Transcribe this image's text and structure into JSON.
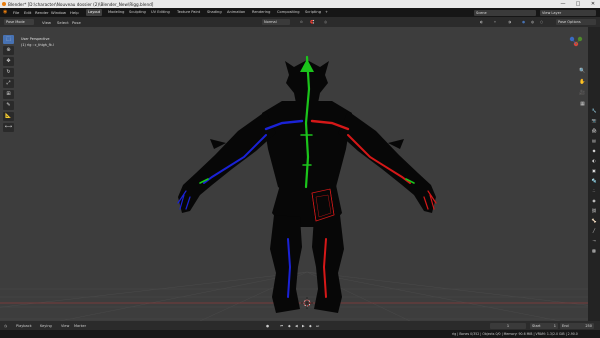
{
  "window": {
    "title": "Blender* [D:\\character\\Nouveau dossier (2)\\Blender_New\\Rigg.blend]",
    "controls": [
      "—",
      "□",
      "✕"
    ]
  },
  "menu": [
    "File",
    "Edit",
    "Render",
    "Window",
    "Help"
  ],
  "workspaces": [
    "Layout",
    "Modeling",
    "Sculpting",
    "UV Editing",
    "Texture Paint",
    "Shading",
    "Animation",
    "Rendering",
    "Compositing",
    "Scripting"
  ],
  "active_workspace": "Layout",
  "add_workspace": "+",
  "scene": {
    "name": "Scene",
    "view_layer": "View Layer"
  },
  "header": {
    "mode": "Pose Mode",
    "view_menu": [
      "View",
      "Select",
      "Pose"
    ],
    "orientation": "Normal",
    "pose_options": "Pose Options"
  },
  "overlay": {
    "line1": "User Perspective",
    "line2": "(1) rig : c_thigh_fk.l"
  },
  "tools": [
    "select-box",
    "cursor",
    "move",
    "rotate",
    "scale",
    "transform",
    "annotate",
    "measure",
    "bone-size"
  ],
  "nav_icons": [
    "zoom-icon",
    "pan-hand-icon",
    "camera-icon",
    "perspective-grid-icon"
  ],
  "properties_icons": [
    "tool-icon",
    "render-icon",
    "output-icon",
    "view-layer-icon",
    "scene-icon",
    "world-icon",
    "object-icon",
    "modifier-icon",
    "particles-icon",
    "physics-icon",
    "constraints-icon",
    "armature-data-icon",
    "bone-icon",
    "bone-constraint-icon",
    "texture-icon"
  ],
  "timeline": {
    "playback": "Playback",
    "keying": "Keying",
    "view": "View",
    "marker": "Marker",
    "current_frame": "1",
    "start_label": "Start",
    "start": "1",
    "end_label": "End",
    "end": "250"
  },
  "statusbar": "rig | Bones 0/352 | Objects 0/0 | Memory: 90.6 MiB | VRAM: 1.3/2.0 GiB | 2.90.0",
  "colors": {
    "accent": "#4772b3",
    "active_tool": "#4772b3",
    "bone_left": "#d51818",
    "bone_right": "#1a22d6",
    "bone_center": "#1bc41b",
    "viewport_bg": "#3d3d3d",
    "title_bar": "#e9e9e9"
  }
}
